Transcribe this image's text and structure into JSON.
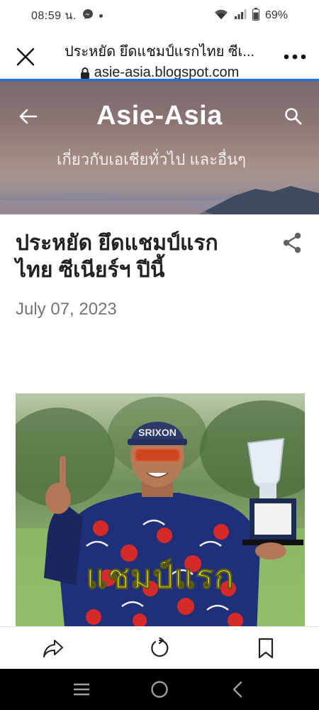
{
  "status_bar": {
    "time": "08:59 น.",
    "battery": "69%",
    "icons": [
      "messenger-icon",
      "wifi-icon",
      "signal-icon",
      "battery-icon"
    ]
  },
  "browser": {
    "page_title": "ประหยัด ยึดแชมป์แรกไทย ซีเ...",
    "url": "asie-asia.blogspot.com",
    "icons": [
      "close-icon",
      "lock-icon",
      "more-vertical-icon"
    ],
    "progress_color": "#1a73e8"
  },
  "blog": {
    "title": "Asie-Asia",
    "description": "เกี่ยวกับเอเชียทั่วไป และอื่นๆ",
    "icons": [
      "back-arrow-icon",
      "search-icon"
    ]
  },
  "post": {
    "title": "ประหยัด ยึดแชมป์แรก ไทย ซีเนียร์ฯ ปีนี้",
    "date": "July 07, 2023",
    "image_caption": "แชมป์แรก",
    "icons": [
      "share-icon"
    ]
  },
  "toolbar": {
    "icons": [
      "forward-share-icon",
      "reload-icon",
      "bookmark-icon"
    ]
  },
  "nav": {
    "icons": [
      "recents-icon",
      "home-icon",
      "back-icon"
    ]
  },
  "colors": {
    "accent": "#1a73e8",
    "caption": "#f2ef3a",
    "date": "#757575"
  }
}
